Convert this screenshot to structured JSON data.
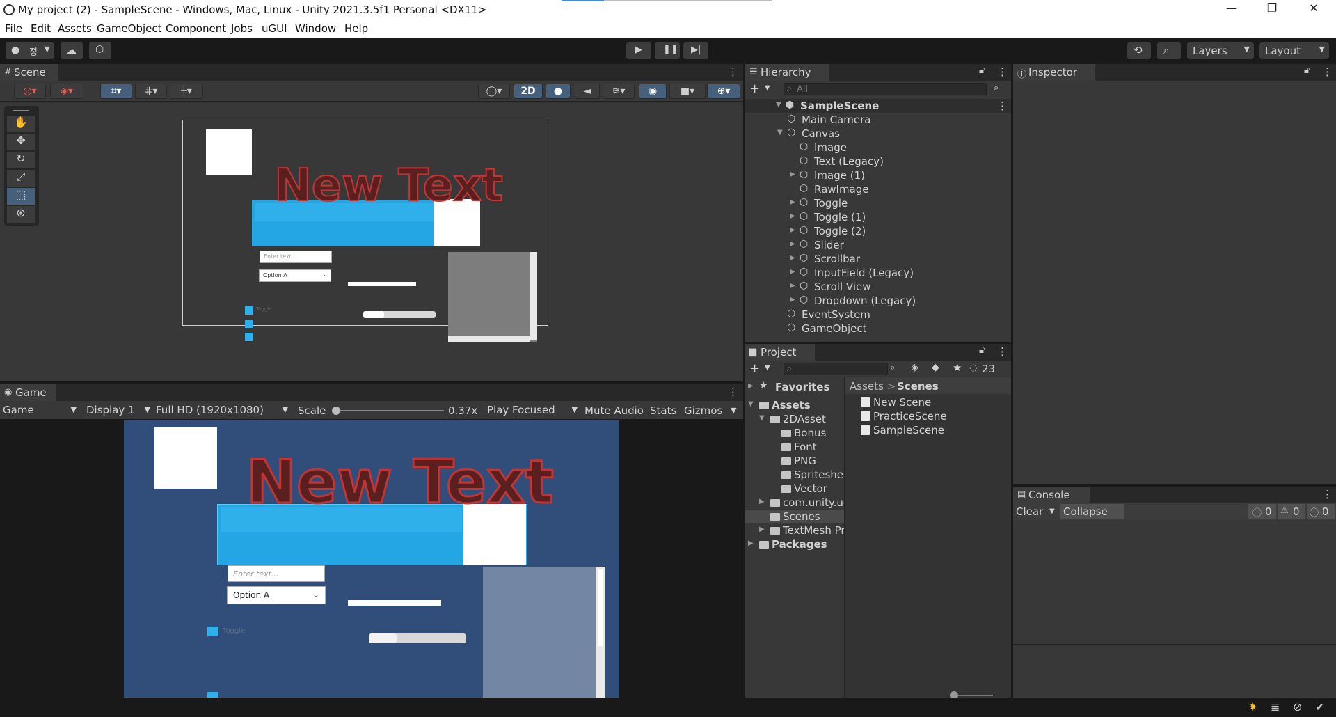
{
  "titlebar": {
    "title": "My project (2) - SampleScene - Windows, Mac, Linux - Unity 2021.3.5f1 Personal <DX11>",
    "minimize": "—",
    "maximize": "❐",
    "close": "✕"
  },
  "menubar": [
    "File",
    "Edit",
    "Assets",
    "GameObject",
    "Component",
    "Jobs",
    "uGUI",
    "Window",
    "Help"
  ],
  "toolbar": {
    "account_label": "정",
    "layers_label": "Layers",
    "layout_label": "Layout"
  },
  "scene": {
    "tab_label": "Scene",
    "mode_2d": "2D",
    "canvas_text": "New Text",
    "input_placeholder": "Enter text...",
    "dropdown_value": "Option A",
    "toggle_label": "Toggle"
  },
  "game": {
    "tab_label": "Game",
    "view_select": "Game",
    "display_select": "Display 1",
    "resolution_select": "Full HD (1920x1080)",
    "scale_label": "Scale",
    "scale_value": "0.37x",
    "play_mode": "Play Focused",
    "mute_audio": "Mute Audio",
    "stats": "Stats",
    "gizmos": "Gizmos",
    "canvas_text": "New Text",
    "input_placeholder": "Enter text...",
    "dropdown_value": "Option A",
    "toggle_label": "Toggle"
  },
  "hierarchy": {
    "tab_label": "Hierarchy",
    "search_placeholder": "All",
    "scene_name": "SampleScene",
    "items": [
      {
        "label": "Main Camera",
        "depth": 1,
        "arrow": ""
      },
      {
        "label": "Canvas",
        "depth": 1,
        "arrow": "▼"
      },
      {
        "label": "Image",
        "depth": 2,
        "arrow": ""
      },
      {
        "label": "Text (Legacy)",
        "depth": 2,
        "arrow": ""
      },
      {
        "label": "Image (1)",
        "depth": 2,
        "arrow": "▶"
      },
      {
        "label": "RawImage",
        "depth": 2,
        "arrow": ""
      },
      {
        "label": "Toggle",
        "depth": 2,
        "arrow": "▶"
      },
      {
        "label": "Toggle (1)",
        "depth": 2,
        "arrow": "▶"
      },
      {
        "label": "Toggle (2)",
        "depth": 2,
        "arrow": "▶"
      },
      {
        "label": "Slider",
        "depth": 2,
        "arrow": "▶"
      },
      {
        "label": "Scrollbar",
        "depth": 2,
        "arrow": "▶"
      },
      {
        "label": "InputField (Legacy)",
        "depth": 2,
        "arrow": "▶"
      },
      {
        "label": "Scroll View",
        "depth": 2,
        "arrow": "▶"
      },
      {
        "label": "Dropdown (Legacy)",
        "depth": 2,
        "arrow": "▶"
      },
      {
        "label": "EventSystem",
        "depth": 1,
        "arrow": ""
      },
      {
        "label": "GameObject",
        "depth": 1,
        "arrow": ""
      }
    ]
  },
  "inspector": {
    "tab_label": "Inspector"
  },
  "project": {
    "tab_label": "Project",
    "hidden_count": "23",
    "favorites": "Favorites",
    "tree": [
      {
        "label": "Assets",
        "depth": 0,
        "arrow": "▼",
        "bold": true
      },
      {
        "label": "2DAsset",
        "depth": 1,
        "arrow": "▼",
        "bold": false
      },
      {
        "label": "Bonus",
        "depth": 2,
        "arrow": "",
        "bold": false
      },
      {
        "label": "Font",
        "depth": 2,
        "arrow": "",
        "bold": false
      },
      {
        "label": "PNG",
        "depth": 2,
        "arrow": "",
        "bold": false
      },
      {
        "label": "Spritesheet",
        "depth": 2,
        "arrow": "",
        "bold": false
      },
      {
        "label": "Vector",
        "depth": 2,
        "arrow": "",
        "bold": false
      },
      {
        "label": "com.unity.ugui",
        "depth": 1,
        "arrow": "▶",
        "bold": false
      },
      {
        "label": "Scenes",
        "depth": 1,
        "arrow": "",
        "bold": false
      },
      {
        "label": "TextMesh Pro",
        "depth": 1,
        "arrow": "▶",
        "bold": false
      },
      {
        "label": "Packages",
        "depth": 0,
        "arrow": "▶",
        "bold": true
      }
    ],
    "breadcrumb_root": "Assets",
    "breadcrumb_sep": ">",
    "breadcrumb_current": "Scenes",
    "files": [
      "New Scene",
      "PracticeScene",
      "SampleScene"
    ]
  },
  "console": {
    "tab_label": "Console",
    "clear": "Clear",
    "collapse": "Collapse",
    "log_count": "0",
    "warn_count": "0",
    "error_count": "0"
  },
  "colors": {
    "accent_blue": "#2fb0ea",
    "game_bg": "#314d79",
    "text_red": "#5a1f1f"
  }
}
